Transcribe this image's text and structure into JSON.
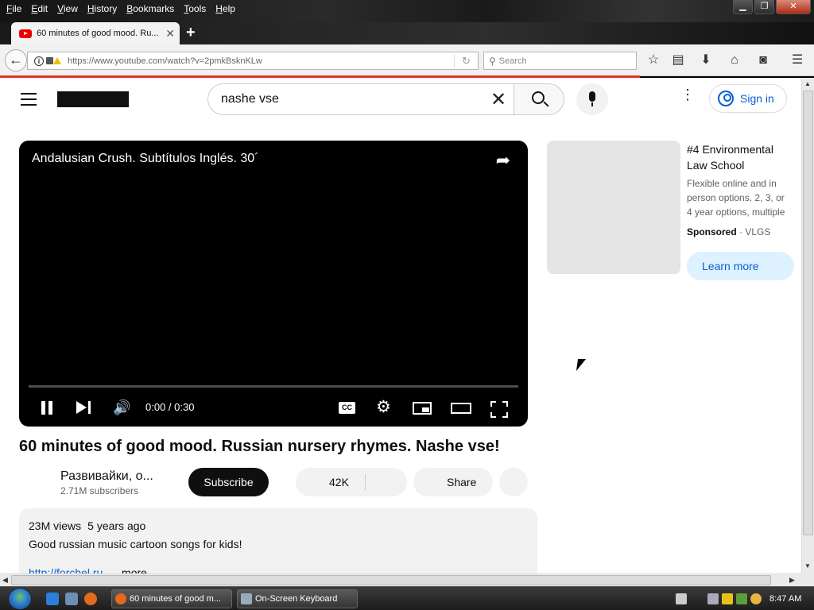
{
  "menu": [
    {
      "key": "F",
      "rest": "ile"
    },
    {
      "key": "E",
      "rest": "dit"
    },
    {
      "key": "V",
      "rest": "iew"
    },
    {
      "key": "H",
      "rest": "istory"
    },
    {
      "key": "B",
      "rest": "ookmarks"
    },
    {
      "key": "T",
      "rest": "ools"
    },
    {
      "key": "H",
      "rest": "elp"
    }
  ],
  "window_controls": {
    "minimize": "▁",
    "restore": "❐",
    "close": "✕"
  },
  "tab": {
    "title": "60 minutes of good mood. Ru...",
    "close": "✕",
    "new_tab": "+"
  },
  "navbar": {
    "url": "https://www.youtube.com/watch?v=2pmkBsknKLw",
    "search_placeholder": "Search",
    "back": "←",
    "reload": "↻",
    "icons": [
      "star-icon",
      "reading-list-icon",
      "download-icon",
      "home-icon",
      "pocket-icon",
      "menu-icon"
    ]
  },
  "youtube": {
    "search_query": "nashe vse",
    "clear": "✕",
    "more": "⋮",
    "signin": "Sign in",
    "player": {
      "overlay_title": "Andalusian Crush. Subtítulos Inglés. 30´",
      "share": "➦",
      "time": "0:00 / 0:30",
      "cc": "CC",
      "volume": "🔊",
      "settings": "⚙",
      "progress": 0.0
    },
    "video_title": "60 minutes of good mood. Russian nursery rhymes. Nashe vse!",
    "channel": {
      "name": "Развивайки, о...",
      "subscribers": "2.71M subscribers"
    },
    "subscribe": "Subscribe",
    "likes": "42K",
    "share": "Share",
    "description": {
      "views": "23M views",
      "age": "5 years ago",
      "text": "Good russian music cartoon songs for kids!",
      "link": "http://forchel.ru",
      "more": "...more"
    },
    "ad": {
      "title": "#4 Environmental Law School",
      "description": "Flexible online and in person options. 2, 3, or 4 year options, multiple",
      "sponsored": "Sponsored",
      "separator": " · ",
      "advertiser": "VLGS",
      "cta": "Learn more"
    }
  },
  "taskbar": {
    "buttons": [
      {
        "label": "60 minutes of good m..."
      },
      {
        "label": "On-Screen Keyboard"
      }
    ],
    "clock": "8:47 AM"
  },
  "colors": {
    "accent": "#065fd4",
    "youtube_red": "#ff0000",
    "loadbar": "#dd3322"
  }
}
